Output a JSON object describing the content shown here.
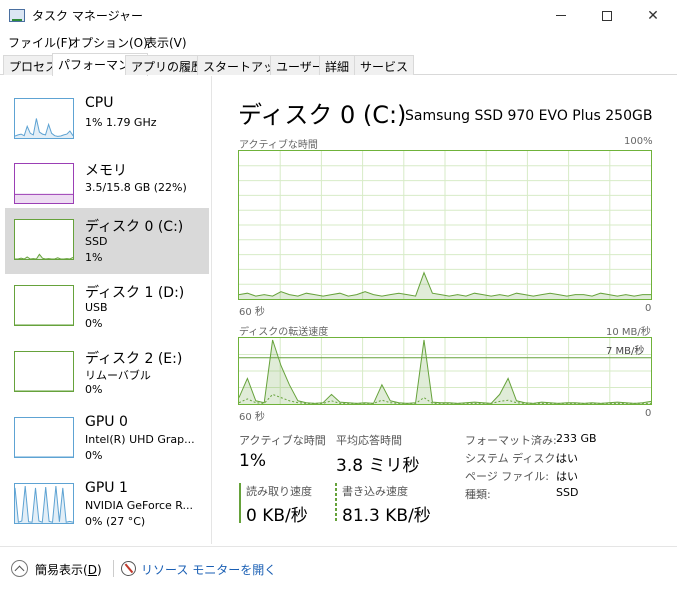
{
  "window": {
    "title": "タスク マネージャー",
    "minimize_glyph": "—",
    "maximize_glyph": "☐",
    "close_glyph": "✕"
  },
  "menu": [
    "ファイル(F)",
    "オプション(O)",
    "表示(V)"
  ],
  "tabs": [
    "プロセス",
    "パフォーマンス",
    "アプリの履歴",
    "スタートアップ",
    "ユーザー",
    "詳細",
    "サービス"
  ],
  "active_tab": "パフォーマンス",
  "sidebar": [
    {
      "name": "CPU",
      "sub1": "1%  1.79 GHz",
      "sub2": "",
      "color": "#5ea3d3",
      "values": [
        0.05,
        0.08,
        0.1,
        0.06,
        0.3,
        0.12,
        0.08,
        0.5,
        0.15,
        0.1,
        0.08,
        0.35,
        0.12,
        0.06,
        0.04,
        0.05,
        0.08,
        0.1,
        0.18,
        0.06
      ]
    },
    {
      "name": "メモリ",
      "sub1": "3.5/15.8 GB (22%)",
      "sub2": "",
      "color": "#9b3fb5",
      "values": [
        0.22,
        0.22,
        0.22,
        0.22,
        0.22,
        0.22,
        0.22,
        0.22,
        0.22,
        0.22,
        0.22,
        0.22
      ]
    },
    {
      "name": "ディスク 0 (C:)",
      "sub1": "SSD",
      "sub2": "1%",
      "color": "#66a23b",
      "values": [
        0,
        0,
        0.02,
        0,
        0.05,
        0,
        0.01,
        0,
        0.12,
        0.02,
        0,
        0.01,
        0,
        0,
        0.03,
        0,
        0,
        0.01,
        0,
        0.04
      ]
    },
    {
      "name": "ディスク 1 (D:)",
      "sub1": "USB",
      "sub2": "0%",
      "color": "#66a23b",
      "values": [
        0,
        0,
        0,
        0,
        0,
        0,
        0,
        0,
        0,
        0
      ]
    },
    {
      "name": "ディスク 2 (E:)",
      "sub1": "リムーバブル",
      "sub2": "0%",
      "color": "#66a23b",
      "values": [
        0,
        0,
        0,
        0,
        0,
        0,
        0,
        0,
        0,
        0
      ]
    },
    {
      "name": "GPU 0",
      "sub1": "Intel(R) UHD Grap...",
      "sub2": "0%",
      "color": "#5ea3d3",
      "values": [
        0,
        0,
        0,
        0,
        0,
        0,
        0,
        0,
        0,
        0
      ]
    },
    {
      "name": "GPU 1",
      "sub1": "NVIDIA GeForce R...",
      "sub2": "0%  (27 °C)",
      "color": "#5ea3d3",
      "values": [
        0.9,
        0.02,
        0.05,
        0.95,
        0.03,
        0.02,
        0.9,
        0.05,
        0.02,
        0.92,
        0.04,
        0.02,
        0.95,
        0.03,
        0.9,
        0.02,
        0.04,
        0.02
      ]
    }
  ],
  "main": {
    "title": "ディスク 0 (C:)",
    "model": "Samsung SSD 970 EVO Plus 250GB",
    "graph1": {
      "label": "アクティブな時間",
      "max_label": "100%",
      "left_label": "60 秒",
      "right_label": "0",
      "values": [
        0.03,
        0.04,
        0.02,
        0.03,
        0.02,
        0.05,
        0.03,
        0.02,
        0.04,
        0.03,
        0.02,
        0.03,
        0.04,
        0.02,
        0.03,
        0.05,
        0.03,
        0.02,
        0.03,
        0.04,
        0.03,
        0.02,
        0.18,
        0.04,
        0.03,
        0.02,
        0.03,
        0.02,
        0.04,
        0.03,
        0.02,
        0.03,
        0.02,
        0.04,
        0.03,
        0.02,
        0.03,
        0.04,
        0.03,
        0.02,
        0.03,
        0.03,
        0.02,
        0.04,
        0.03,
        0.02,
        0.03,
        0.02,
        0.03,
        0.03
      ]
    },
    "graph2": {
      "label": "ディスクの転送速度",
      "max_label": "10 MB/秒",
      "inner_label": "7 MB/秒",
      "left_label": "60 秒",
      "right_label": "0",
      "values": [
        0.1,
        0.4,
        0.05,
        0.02,
        1.0,
        0.6,
        0.3,
        0.05,
        0.02,
        0.01,
        0.02,
        0.15,
        0.03,
        0.02,
        0.01,
        0.02,
        0.01,
        0.3,
        0.05,
        0.02,
        0.01,
        0.02,
        1.0,
        0.03,
        0.02,
        0.02,
        0.01,
        0.02,
        0.03,
        0.02,
        0.01,
        0.15,
        0.4,
        0.05,
        0.02,
        0.01,
        0.03,
        0.02,
        0.01,
        0.02,
        0.02,
        0.01,
        0.02,
        0.01,
        0.02,
        0.03,
        0.02,
        0.01,
        0.02,
        0.04
      ],
      "read_values": [
        0.02,
        0.08,
        0.02,
        0.01,
        0.15,
        0.1,
        0.05,
        0.02,
        0.01,
        0.01,
        0.01,
        0.05,
        0.01,
        0.01,
        0.01,
        0.01,
        0.01,
        0.06,
        0.02,
        0.01,
        0.01,
        0.01,
        0.1,
        0.01,
        0.01,
        0.01,
        0.01,
        0.01,
        0.01,
        0.01,
        0.01,
        0.04,
        0.06,
        0.02,
        0.01,
        0.01,
        0.01,
        0.01,
        0.01,
        0.01,
        0.01,
        0.01,
        0.01,
        0.01,
        0.01,
        0.01,
        0.01,
        0.01,
        0.01,
        0.01
      ]
    },
    "active_time_label": "アクティブな時間",
    "active_time_value": "1%",
    "response_label": "平均応答時間",
    "response_value": "3.8 ミリ秒",
    "read_label": "読み取り速度",
    "read_value": "0 KB/秒",
    "write_label": "書き込み速度",
    "write_value": "81.3 KB/秒",
    "props": [
      {
        "k": "フォーマット済み:",
        "v": "233 GB"
      },
      {
        "k": "システム ディスク:",
        "v": "はい"
      },
      {
        "k": "ページ ファイル:",
        "v": "はい"
      },
      {
        "k": "種類:",
        "v": "SSD"
      }
    ]
  },
  "footer": {
    "fewer_details": "簡易表示(",
    "fewer_details_key": "D",
    "fewer_details_end": ")",
    "resource_monitor": "リソース モニターを開く"
  },
  "colors": {
    "disk_green": "#66a23b",
    "cpu_blue": "#5ea3d3",
    "memory_purple": "#9b3fb5",
    "link_blue": "#1a5fb4"
  }
}
